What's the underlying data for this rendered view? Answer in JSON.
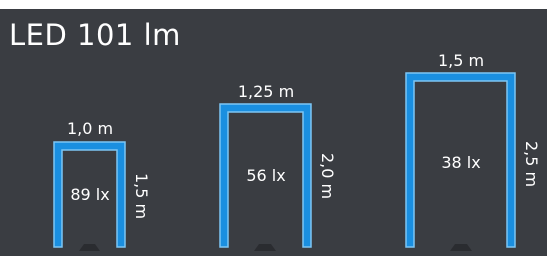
{
  "title": "LED 101 lm",
  "colors": {
    "background": "#3a3d42",
    "frame_fill": "#1a8fe0",
    "frame_edge": "#7cc6f4",
    "text": "#ffffff",
    "lamp": "#2a2c30"
  },
  "frames": [
    {
      "width_label": "1,0 m",
      "height_label": "1,5 m",
      "lux_label": "89 lx"
    },
    {
      "width_label": "1,25 m",
      "height_label": "2,0 m",
      "lux_label": "56 lx"
    },
    {
      "width_label": "1,5 m",
      "height_label": "2,5 m",
      "lux_label": "38 lx"
    }
  ]
}
